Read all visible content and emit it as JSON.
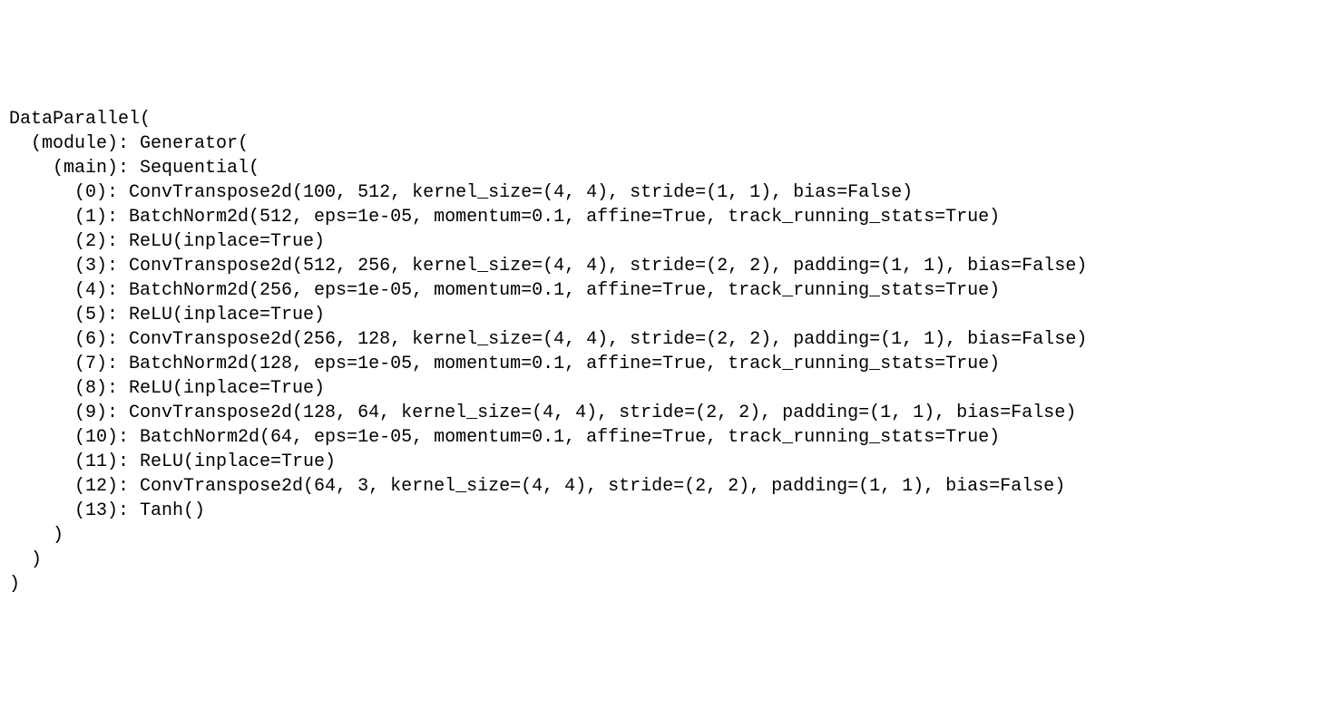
{
  "model": {
    "wrapper": "DataParallel",
    "module_key": "(module)",
    "module_name": "Generator",
    "main_key": "(main)",
    "main_name": "Sequential",
    "layers": [
      {
        "idx": "0",
        "repr": "ConvTranspose2d(100, 512, kernel_size=(4, 4), stride=(1, 1), bias=False)"
      },
      {
        "idx": "1",
        "repr": "BatchNorm2d(512, eps=1e-05, momentum=0.1, affine=True, track_running_stats=True)"
      },
      {
        "idx": "2",
        "repr": "ReLU(inplace=True)"
      },
      {
        "idx": "3",
        "repr": "ConvTranspose2d(512, 256, kernel_size=(4, 4), stride=(2, 2), padding=(1, 1), bias=False)"
      },
      {
        "idx": "4",
        "repr": "BatchNorm2d(256, eps=1e-05, momentum=0.1, affine=True, track_running_stats=True)"
      },
      {
        "idx": "5",
        "repr": "ReLU(inplace=True)"
      },
      {
        "idx": "6",
        "repr": "ConvTranspose2d(256, 128, kernel_size=(4, 4), stride=(2, 2), padding=(1, 1), bias=False)"
      },
      {
        "idx": "7",
        "repr": "BatchNorm2d(128, eps=1e-05, momentum=0.1, affine=True, track_running_stats=True)"
      },
      {
        "idx": "8",
        "repr": "ReLU(inplace=True)"
      },
      {
        "idx": "9",
        "repr": "ConvTranspose2d(128, 64, kernel_size=(4, 4), stride=(2, 2), padding=(1, 1), bias=False)"
      },
      {
        "idx": "10",
        "repr": "BatchNorm2d(64, eps=1e-05, momentum=0.1, affine=True, track_running_stats=True)"
      },
      {
        "idx": "11",
        "repr": "ReLU(inplace=True)"
      },
      {
        "idx": "12",
        "repr": "ConvTranspose2d(64, 3, kernel_size=(4, 4), stride=(2, 2), padding=(1, 1), bias=False)"
      },
      {
        "idx": "13",
        "repr": "Tanh()"
      }
    ]
  }
}
